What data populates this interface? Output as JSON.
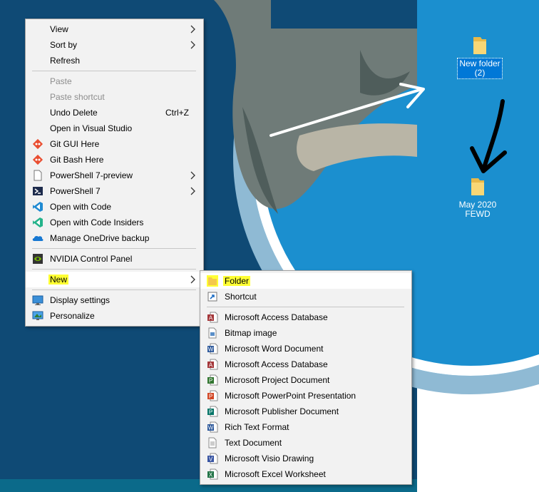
{
  "desktop": {
    "icons": [
      {
        "label_line1": "New folder",
        "label_line2": "(2)",
        "selected": true
      },
      {
        "label_line1": "May 2020",
        "label_line2": "FEWD",
        "selected": false
      }
    ]
  },
  "context_menu": {
    "view": "View",
    "sort_by": "Sort by",
    "refresh": "Refresh",
    "paste": "Paste",
    "paste_shortcut": "Paste shortcut",
    "undo_delete": "Undo Delete",
    "undo_delete_shortcut": "Ctrl+Z",
    "open_visual_studio": "Open in Visual Studio",
    "git_gui": "Git GUI Here",
    "git_bash": "Git Bash Here",
    "powershell_preview": "PowerShell 7-preview",
    "powershell": "PowerShell 7",
    "open_code": "Open with Code",
    "open_code_insiders": "Open with Code Insiders",
    "onedrive": "Manage OneDrive backup",
    "nvidia": "NVIDIA Control Panel",
    "new": "New",
    "display_settings": "Display settings",
    "personalize": "Personalize"
  },
  "new_submenu": {
    "folder": "Folder",
    "shortcut": "Shortcut",
    "access_db_1": "Microsoft Access Database",
    "bitmap": "Bitmap image",
    "word": "Microsoft Word Document",
    "access_db_2": "Microsoft Access Database",
    "project": "Microsoft Project Document",
    "powerpoint": "Microsoft PowerPoint Presentation",
    "publisher": "Microsoft Publisher Document",
    "rtf": "Rich Text Format",
    "text": "Text Document",
    "visio": "Microsoft Visio Drawing",
    "excel": "Microsoft Excel Worksheet"
  },
  "colors": {
    "desktop_blue": "#0e3f66",
    "selection_blue": "#0078d7",
    "highlight_yellow": "#ffff33",
    "menu_bg": "#f2f2f2"
  },
  "icons": {
    "git": "git-icon",
    "powershell": "powershell-icon",
    "vscode": "vscode-icon",
    "onedrive": "onedrive-icon",
    "nvidia": "nvidia-icon",
    "display": "display-icon",
    "personalize": "personalize-icon",
    "folder": "folder-icon"
  }
}
